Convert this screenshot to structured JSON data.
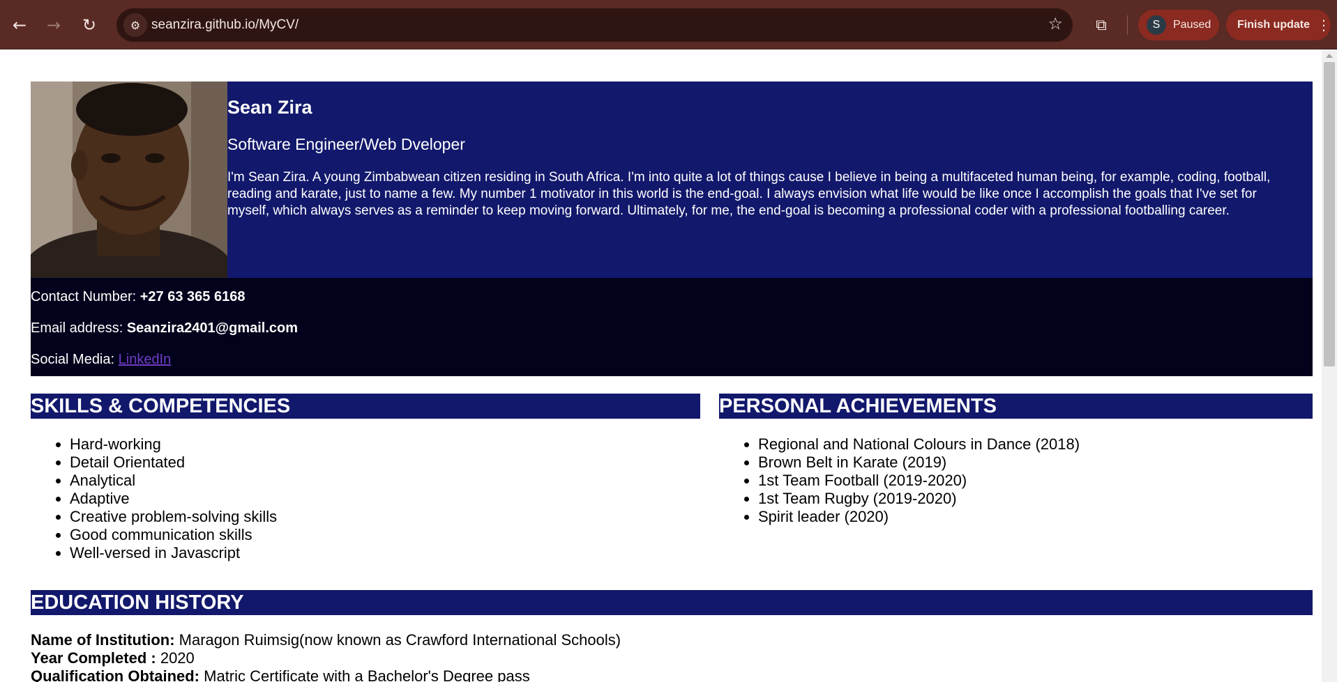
{
  "browser": {
    "url": "seanzira.github.io/MyCV/",
    "profile_initial": "S",
    "profile_status": "Paused",
    "update_label": "Finish update"
  },
  "cv": {
    "name": "Sean Zira",
    "role": "Software Engineer/Web Dveloper",
    "bio": "I'm Sean Zira. A young Zimbabwean citizen residing in South Africa. I'm into quite a lot of things cause I believe in being a multifaceted human being, for example, coding, football, reading and karate, just to name a few. My number 1 motivator in this world is the end-goal. I always envision what life would be like once I accomplish the goals that I've set for myself, which always serves as a reminder to keep moving forward. Ultimately, for me, the end-goal is becoming a professional coder with a professional footballing career.",
    "contact": {
      "phone_label": "Contact Number: ",
      "phone_value": "+27 63 365 6168",
      "email_label": "Email address: ",
      "email_value": "Seanzira2401@gmail.com",
      "social_label": "Social Media: ",
      "social_link": "LinkedIn"
    },
    "skills": {
      "title": "SKILLS & COMPETENCIES",
      "items": [
        "Hard-working",
        "Detail Orientated",
        "Analytical",
        "Adaptive",
        "Creative problem-solving skills",
        "Good communication skills",
        "Well-versed in Javascript"
      ]
    },
    "achievements": {
      "title": "PERSONAL ACHIEVEMENTS",
      "items": [
        "Regional and National Colours in Dance (2018)",
        "Brown Belt in Karate (2019)",
        "1st Team Football (2019-2020)",
        "1st Team Rugby (2019-2020)",
        "Spirit leader (2020)"
      ]
    },
    "education": {
      "title": "EDUCATION HISTORY",
      "institution_label": "Name of Institution:",
      "institution_value": " Maragon Ruimsig(now known as Crawford International Schools)",
      "year_label": "Year Completed :",
      "year_value": " 2020",
      "qualification_label": "Qualification Obtained:",
      "qualification_value": " Matric Certificate with a Bachelor's Degree pass"
    }
  }
}
